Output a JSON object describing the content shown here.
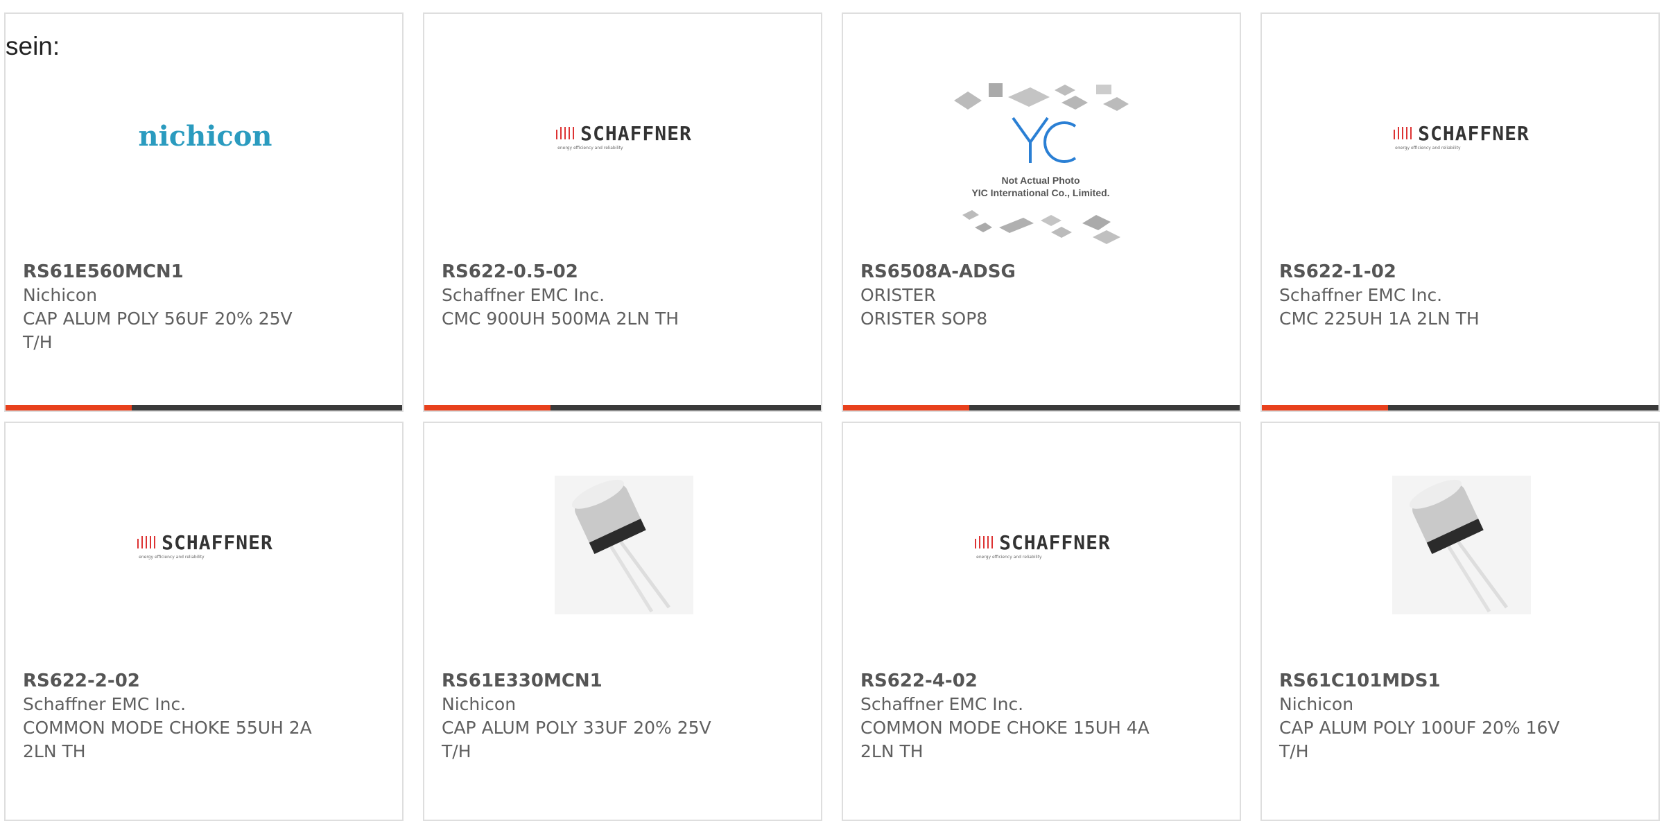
{
  "page": {
    "lead_text": "sein:"
  },
  "colors": {
    "accent": "#e8401c",
    "bar": "#3a3a3a",
    "border": "#dedede"
  },
  "logos": {
    "nichicon": "nichicon",
    "schaffner": "SCHAFFNER",
    "schaffner_tag": "energy efficiency and reliability",
    "yic_line1": "Not Actual Photo",
    "yic_line2": "YIC International Co., Limited."
  },
  "products": [
    {
      "part": "RS61E560MCN1",
      "maker": "Nichicon",
      "desc": "CAP ALUM POLY 56UF 20% 25V\nT/H",
      "image": "nichicon-logo"
    },
    {
      "part": "RS622-0.5-02",
      "maker": "Schaffner EMC Inc.",
      "desc": "CMC 900UH 500MA 2LN TH",
      "image": "schaffner-logo"
    },
    {
      "part": "RS6508A-ADSG",
      "maker": "ORISTER",
      "desc": "ORISTER SOP8",
      "image": "yic-placeholder"
    },
    {
      "part": "RS622-1-02",
      "maker": "Schaffner EMC Inc.",
      "desc": "CMC 225UH 1A 2LN TH",
      "image": "schaffner-logo"
    },
    {
      "part": "RS622-2-02",
      "maker": "Schaffner EMC Inc.",
      "desc": "COMMON MODE CHOKE 55UH 2A\n2LN TH",
      "image": "schaffner-logo"
    },
    {
      "part": "RS61E330MCN1",
      "maker": "Nichicon",
      "desc": "CAP ALUM POLY 33UF 20% 25V\nT/H",
      "image": "capacitor-photo"
    },
    {
      "part": "RS622-4-02",
      "maker": "Schaffner EMC Inc.",
      "desc": "COMMON MODE CHOKE 15UH 4A\n2LN TH",
      "image": "schaffner-logo"
    },
    {
      "part": "RS61C101MDS1",
      "maker": "Nichicon",
      "desc": "CAP ALUM POLY 100UF 20% 16V\nT/H",
      "image": "capacitor-photo"
    }
  ]
}
